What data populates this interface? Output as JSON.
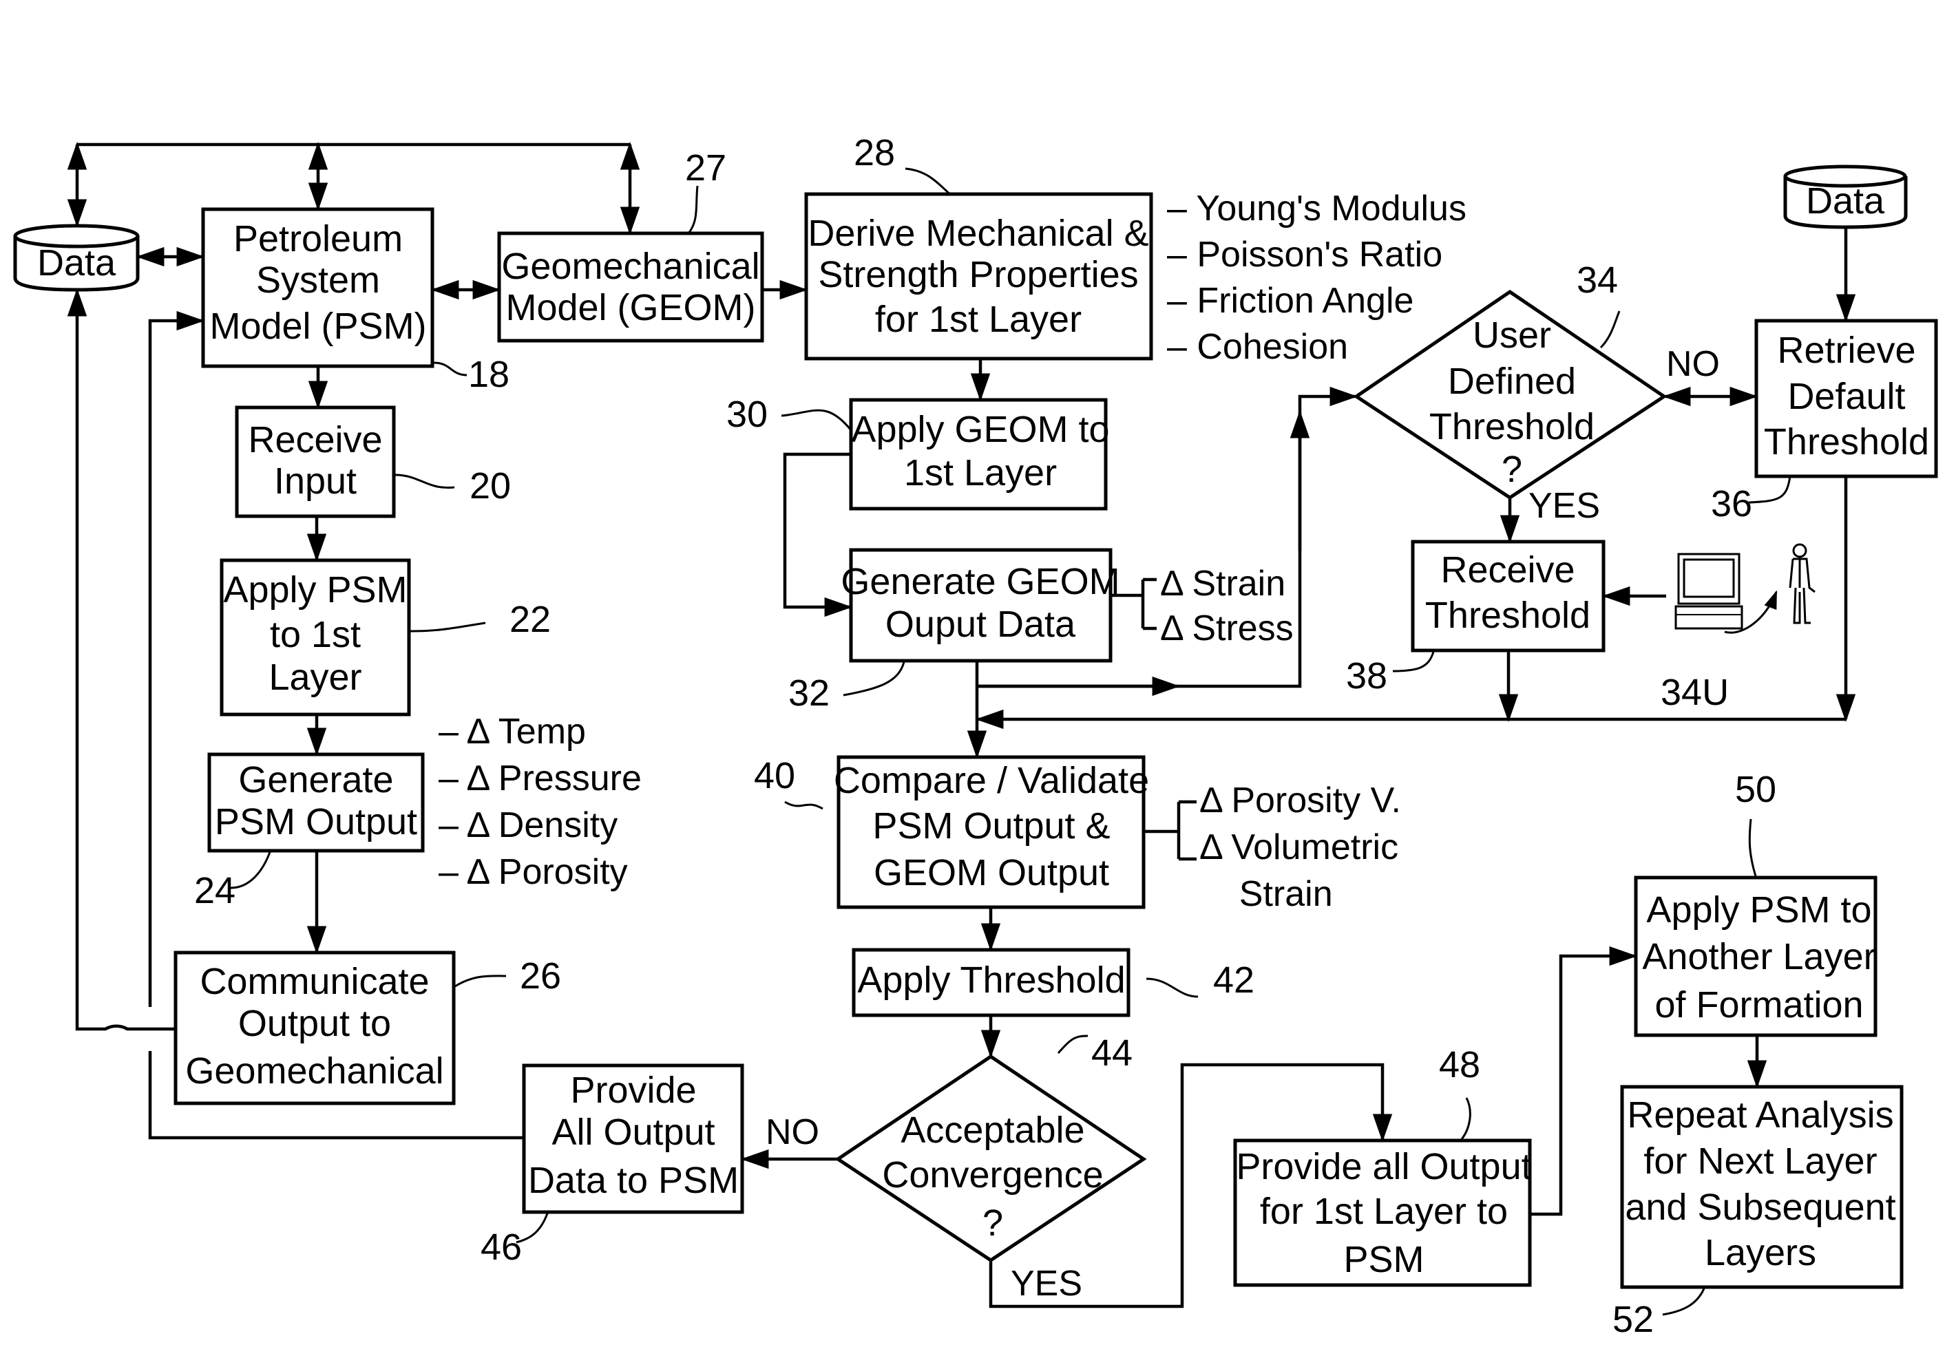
{
  "diagram": {
    "nodes": {
      "data_left": {
        "label": [
          "Data"
        ],
        "shape": "database"
      },
      "psm": {
        "label": [
          "Petroleum",
          "System",
          "Model (PSM)"
        ],
        "ref": "18"
      },
      "geom": {
        "label": [
          "Geomechanical",
          "Model (GEOM)"
        ],
        "ref": "27"
      },
      "derive": {
        "label": [
          "Derive Mechanical &",
          "Strength Properties",
          "for 1st Layer"
        ],
        "ref": "28"
      },
      "receive_input": {
        "label": [
          "Receive",
          "Input"
        ],
        "ref": "20"
      },
      "apply_psm": {
        "label": [
          "Apply PSM",
          "to 1st",
          "Layer"
        ],
        "ref": "22"
      },
      "generate_psm": {
        "label": [
          "Generate",
          "PSM Output"
        ],
        "ref": "24"
      },
      "communicate": {
        "label": [
          "Communicate",
          "Output to",
          "Geomechanical"
        ],
        "ref": "26"
      },
      "apply_geom": {
        "label": [
          "Apply GEOM to",
          "1st Layer"
        ],
        "ref": "30"
      },
      "generate_geom": {
        "label": [
          "Generate GEOM",
          "Ouput Data"
        ],
        "ref": "32"
      },
      "user_threshold": {
        "label": [
          "User",
          "Defined",
          "Threshold",
          "?"
        ],
        "ref": "34",
        "shape": "decision"
      },
      "retrieve_default": {
        "label": [
          "Retrieve",
          "Default",
          "Threshold"
        ],
        "ref": "36"
      },
      "data_right": {
        "label": [
          "Data"
        ],
        "shape": "database"
      },
      "receive_threshold": {
        "label": [
          "Receive",
          "Threshold"
        ],
        "ref": "38"
      },
      "user_ref": {
        "ref": "34U"
      },
      "compare": {
        "label": [
          "Compare / Validate",
          "PSM Output &",
          "GEOM Output"
        ],
        "ref": "40"
      },
      "apply_threshold": {
        "label": [
          "Apply Threshold"
        ],
        "ref": "42"
      },
      "convergence": {
        "label": [
          "Acceptable",
          "Convergence",
          "?"
        ],
        "ref": "44",
        "shape": "decision"
      },
      "provide_all_output": {
        "label": [
          "Provide",
          "All Output",
          "Data to PSM"
        ],
        "ref": "46"
      },
      "provide_first_layer": {
        "label": [
          "Provide all Output",
          "for 1st Layer to",
          "PSM"
        ],
        "ref": "48"
      },
      "apply_psm_another": {
        "label": [
          "Apply PSM to",
          "Another Layer",
          "of Formation"
        ],
        "ref": "50"
      },
      "repeat_analysis": {
        "label": [
          "Repeat Analysis",
          "for Next Layer",
          "and Subsequent",
          "Layers"
        ],
        "ref": "52"
      }
    },
    "annotations": {
      "mechanical_properties": [
        "– Young's Modulus",
        "– Poisson's Ratio",
        "– Friction Angle",
        "– Cohesion"
      ],
      "psm_outputs": [
        "–   Δ  Temp",
        "–   Δ  Pressure",
        "–   Δ  Density",
        "–   Δ  Porosity"
      ],
      "geom_outputs": [
        "Δ Strain",
        "Δ Stress"
      ],
      "compare_outputs": [
        "Δ  Porosity V.",
        "Δ  Volumetric",
        "    Strain"
      ]
    },
    "edge_labels": {
      "user_no": "NO",
      "user_yes": "YES",
      "convergence_no": "NO",
      "convergence_yes": "YES"
    }
  }
}
